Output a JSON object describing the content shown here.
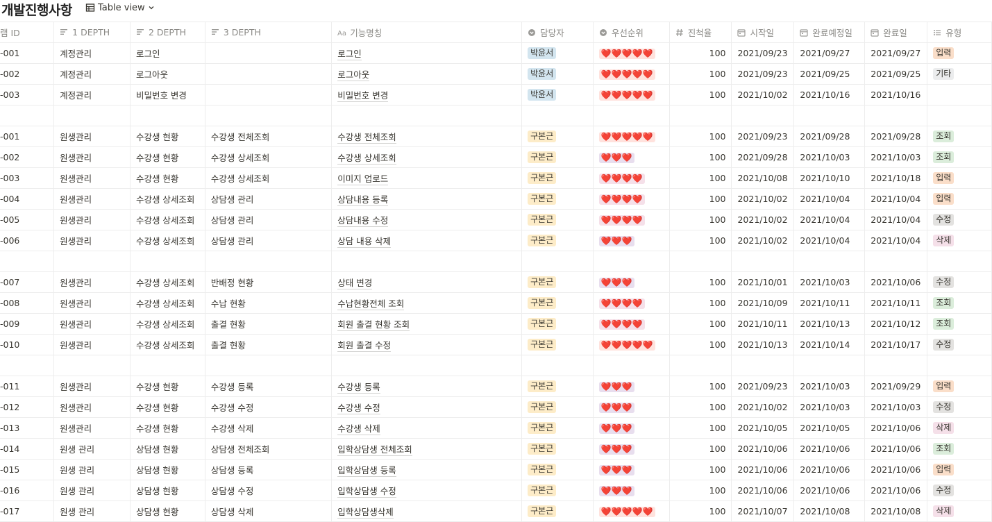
{
  "page": {
    "title": "개발진행사항",
    "view_label": "Table view"
  },
  "columns": [
    {
      "label": "램 ID",
      "icon": ""
    },
    {
      "label": "1 DEPTH",
      "icon": "text-icon"
    },
    {
      "label": "2 DEPTH",
      "icon": "text-icon"
    },
    {
      "label": "3 DEPTH",
      "icon": "text-icon"
    },
    {
      "label": "기능명칭",
      "icon": "title-icon"
    },
    {
      "label": "담당자",
      "icon": "select-icon"
    },
    {
      "label": "우선순위",
      "icon": "select-icon"
    },
    {
      "label": "진척율",
      "icon": "number-icon"
    },
    {
      "label": "시작일",
      "icon": "calendar-icon"
    },
    {
      "label": "완료예정일",
      "icon": "calendar-icon"
    },
    {
      "label": "완료일",
      "icon": "calendar-icon"
    },
    {
      "label": "유형",
      "icon": "list-icon"
    }
  ],
  "tag_colors": {
    "박윤서": "#d3e5ef",
    "구본근": "#fdecc8",
    "입력": "#fadec9",
    "기타": "#ebeced",
    "조회": "#dbeddb",
    "수정": "#e3e2e0",
    "삭제": "#f5e0e9",
    "hearts5": "#ffe2dd",
    "hearts4": "#f5e0e9",
    "hearts3": "#e8deee"
  },
  "rows": [
    {
      "id": "-001",
      "d1": "계정관리",
      "d2": "로그인",
      "d3": "",
      "name": "로그인",
      "owner": "박윤서",
      "priority": "❤️❤️❤️❤️❤️",
      "pbg": "hearts5",
      "progress": "100",
      "start": "2021/09/23",
      "due": "2021/09/27",
      "done": "2021/09/27",
      "type": "입력"
    },
    {
      "id": "-002",
      "d1": "계정관리",
      "d2": "로그아웃",
      "d3": "",
      "name": "로그아웃",
      "owner": "박윤서",
      "priority": "❤️❤️❤️❤️❤️",
      "pbg": "hearts5",
      "progress": "100",
      "start": "2021/09/23",
      "due": "2021/09/25",
      "done": "2021/09/25",
      "type": "기타"
    },
    {
      "id": "-003",
      "d1": "계정관리",
      "d2": "비밀번호 변경",
      "d3": "",
      "name": "비밀번호 변경",
      "owner": "박윤서",
      "priority": "❤️❤️❤️❤️❤️",
      "pbg": "hearts5",
      "progress": "100",
      "start": "2021/10/02",
      "due": "2021/10/16",
      "done": "2021/10/16",
      "type": ""
    },
    {
      "empty": true
    },
    {
      "id": "-001",
      "d1": "원생관리",
      "d2": "수강생 현황",
      "d3": "수강생 전체조회",
      "name": "수강생 전체조회",
      "owner": "구본근",
      "priority": "❤️❤️❤️❤️❤️",
      "pbg": "hearts5",
      "progress": "100",
      "start": "2021/09/23",
      "due": "2021/09/28",
      "done": "2021/09/28",
      "type": "조회"
    },
    {
      "id": "-002",
      "d1": "원생관리",
      "d2": "수강생 현황",
      "d3": "수강생 상세조회",
      "name": "수강생 상세조회",
      "owner": "구본근",
      "priority": "❤️❤️❤️",
      "pbg": "hearts3",
      "progress": "100",
      "start": "2021/09/28",
      "due": "2021/10/03",
      "done": "2021/10/03",
      "type": "조회"
    },
    {
      "id": "-003",
      "d1": "원생관리",
      "d2": "수강생 현황",
      "d3": "수강생 상세조회",
      "name": "이미지 업로드",
      "owner": "구본근",
      "priority": "❤️❤️❤️❤️",
      "pbg": "hearts4",
      "progress": "100",
      "start": "2021/10/08",
      "due": "2021/10/10",
      "done": "2021/10/18",
      "type": "입력"
    },
    {
      "id": "-004",
      "d1": "원생관리",
      "d2": "수강생 상세조회",
      "d3": "상담생 관리",
      "name": "상담내용 등록",
      "owner": "구본근",
      "priority": "❤️❤️❤️❤️",
      "pbg": "hearts4",
      "progress": "100",
      "start": "2021/10/02",
      "due": "2021/10/04",
      "done": "2021/10/04",
      "type": "입력"
    },
    {
      "id": "-005",
      "d1": "원생관리",
      "d2": "수강생 상세조회",
      "d3": "상담생 관리",
      "name": "상담내용 수정",
      "owner": "구본근",
      "priority": "❤️❤️❤️❤️",
      "pbg": "hearts4",
      "progress": "100",
      "start": "2021/10/02",
      "due": "2021/10/04",
      "done": "2021/10/04",
      "type": "수정"
    },
    {
      "id": "-006",
      "d1": "원생관리",
      "d2": "수강생 상세조회",
      "d3": "상담생 관리",
      "name": "상담 내용 삭제",
      "owner": "구본근",
      "priority": "❤️❤️❤️",
      "pbg": "hearts3",
      "progress": "100",
      "start": "2021/10/02",
      "due": "2021/10/04",
      "done": "2021/10/04",
      "type": "삭제"
    },
    {
      "empty": true
    },
    {
      "id": "-007",
      "d1": "원생관리",
      "d2": "수강생 상세조회",
      "d3": "반배정 현황",
      "name": "상태 변경",
      "owner": "구본근",
      "priority": "❤️❤️❤️",
      "pbg": "hearts3",
      "progress": "100",
      "start": "2021/10/01",
      "due": "2021/10/03",
      "done": "2021/10/06",
      "type": "수정"
    },
    {
      "id": "-008",
      "d1": "원생관리",
      "d2": "수강생 상세조회",
      "d3": "수납 현황",
      "name": "수납현황전체 조회",
      "owner": "구본근",
      "priority": "❤️❤️❤️❤️",
      "pbg": "hearts4",
      "progress": "100",
      "start": "2021/10/09",
      "due": "2021/10/11",
      "done": "2021/10/11",
      "type": "조회"
    },
    {
      "id": "-009",
      "d1": "원생관리",
      "d2": "수강생 상세조회",
      "d3": "출결 현황",
      "name": "회원 출결 현황 조회",
      "owner": "구본근",
      "priority": "❤️❤️❤️❤️",
      "pbg": "hearts4",
      "progress": "100",
      "start": "2021/10/11",
      "due": "2021/10/13",
      "done": "2021/10/12",
      "type": "조회"
    },
    {
      "id": "-010",
      "d1": "원생관리",
      "d2": "수강생 상세조회",
      "d3": "출결 현황",
      "name": "회원 출결 수정",
      "owner": "구본근",
      "priority": "❤️❤️❤️❤️❤️",
      "pbg": "hearts5",
      "progress": "100",
      "start": "2021/10/13",
      "due": "2021/10/14",
      "done": "2021/10/17",
      "type": "수정"
    },
    {
      "empty": true
    },
    {
      "id": "-011",
      "d1": "원생관리",
      "d2": "수강생 현황",
      "d3": "수강생 등록",
      "name": "수강생 등록",
      "owner": "구본근",
      "priority": "❤️❤️❤️",
      "pbg": "hearts3",
      "progress": "100",
      "start": "2021/09/23",
      "due": "2021/10/03",
      "done": "2021/09/29",
      "type": "입력"
    },
    {
      "id": "-012",
      "d1": "원생관리",
      "d2": "수강생 현황",
      "d3": "수강생 수정",
      "name": "수강생 수정",
      "owner": "구본근",
      "priority": "❤️❤️❤️",
      "pbg": "hearts3",
      "progress": "100",
      "start": "2021/10/02",
      "due": "2021/10/03",
      "done": "2021/10/03",
      "type": "수정"
    },
    {
      "id": "-013",
      "d1": "원생관리",
      "d2": "수강생 현황",
      "d3": "수강생 삭제",
      "name": "수강생 삭제",
      "owner": "구본근",
      "priority": "❤️❤️❤️",
      "pbg": "hearts3",
      "progress": "100",
      "start": "2021/10/05",
      "due": "2021/10/05",
      "done": "2021/10/06",
      "type": "삭제"
    },
    {
      "id": "-014",
      "d1": "원생 관리",
      "d2": "상담생 현황",
      "d3": "상담생 전체조회",
      "name": "입학상담생 전체조회",
      "owner": "구본근",
      "priority": "❤️❤️❤️",
      "pbg": "hearts3",
      "progress": "100",
      "start": "2021/10/06",
      "due": "2021/10/06",
      "done": "2021/10/06",
      "type": "조회"
    },
    {
      "id": "-015",
      "d1": "원생 관리",
      "d2": "상담생 현황",
      "d3": "상담생 등록",
      "name": "입학상담생 등록",
      "owner": "구본근",
      "priority": "❤️❤️❤️",
      "pbg": "hearts3",
      "progress": "100",
      "start": "2021/10/06",
      "due": "2021/10/06",
      "done": "2021/10/06",
      "type": "입력"
    },
    {
      "id": "-016",
      "d1": "원생 관리",
      "d2": "상담생 현황",
      "d3": "상담생 수정",
      "name": "입학상담생 수정",
      "owner": "구본근",
      "priority": "❤️❤️❤️",
      "pbg": "hearts3",
      "progress": "100",
      "start": "2021/10/06",
      "due": "2021/10/06",
      "done": "2021/10/06",
      "type": "수정"
    },
    {
      "id": "-017",
      "d1": "원생 관리",
      "d2": "상담생 현황",
      "d3": "상담생 삭제",
      "name": "입학상담생삭제",
      "owner": "구본근",
      "priority": "❤️❤️❤️❤️❤️",
      "pbg": "hearts5",
      "progress": "100",
      "start": "2021/10/07",
      "due": "2021/10/08",
      "done": "2021/10/08",
      "type": "삭제"
    }
  ]
}
